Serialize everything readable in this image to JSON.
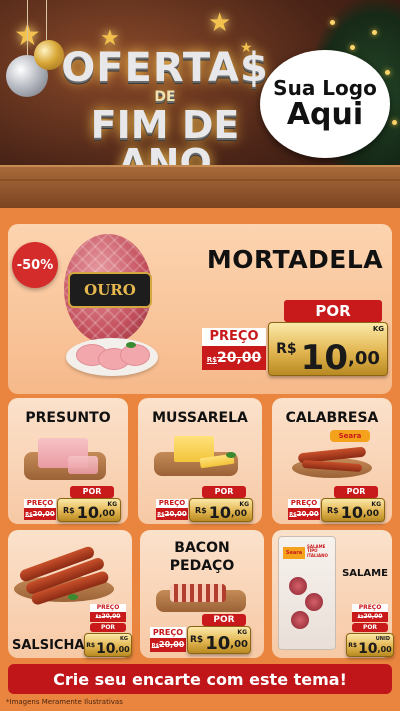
{
  "header": {
    "headline_line1": "OFERTA$",
    "headline_line2": "DE",
    "headline_line3": "FIM DE ANO",
    "logo_line1": "Sua Logo",
    "logo_line2": "Aqui"
  },
  "featured": {
    "discount_badge": "-50%",
    "title": "MORTADELA",
    "brand_label": "OURO",
    "preco_label": "PREÇO",
    "old_price": "20,00",
    "old_price_prefix": "R$",
    "por_label": "POR",
    "currency": "R$",
    "price_int": "10",
    "price_cents": ",00",
    "unit": "KG"
  },
  "products": [
    {
      "name": "PRESUNTO",
      "preco_label": "PREÇO",
      "old_price": "20,00",
      "old_prefix": "R$",
      "por_label": "POR",
      "currency": "R$",
      "price_int": "10",
      "price_cents": ",00",
      "unit": "KG"
    },
    {
      "name": "MUSSARELA",
      "preco_label": "PREÇO",
      "old_price": "20,00",
      "old_prefix": "R$",
      "por_label": "POR",
      "currency": "R$",
      "price_int": "10",
      "price_cents": ",00",
      "unit": "KG"
    },
    {
      "name": "CALABRESA",
      "preco_label": "PREÇO",
      "old_price": "20,00",
      "old_prefix": "R$",
      "por_label": "POR",
      "currency": "R$",
      "price_int": "10",
      "price_cents": ",00",
      "unit": "KG",
      "brand": "Seara"
    },
    {
      "name": "SALSICHA",
      "preco_label": "PREÇO",
      "old_price": "20,00",
      "old_prefix": "R$",
      "por_label": "POR",
      "currency": "R$",
      "price_int": "10",
      "price_cents": ",00",
      "unit": "KG"
    },
    {
      "name_line1": "BACON",
      "name_line2": "PEDAÇO",
      "preco_label": "PREÇO",
      "old_price": "20,00",
      "old_prefix": "R$",
      "por_label": "POR",
      "currency": "R$",
      "price_int": "10",
      "price_cents": ",00",
      "unit": "KG"
    },
    {
      "name": "SALAME",
      "preco_label": "PREÇO",
      "old_price": "20,00",
      "old_prefix": "R$",
      "por_label": "POR",
      "currency": "R$",
      "price_int": "10",
      "price_cents": ",00",
      "unit": "UNID",
      "brand": "Seara",
      "package_text": "SALAME TIPO ITALIANO"
    }
  ],
  "footer": {
    "cta": "Crie seu encarte com este tema!",
    "disclaimer": "*Imagens Meramente Ilustrativas"
  },
  "colors": {
    "background": "#e9853e",
    "accent_red": "#c8191b",
    "gold": "#e2b651"
  }
}
